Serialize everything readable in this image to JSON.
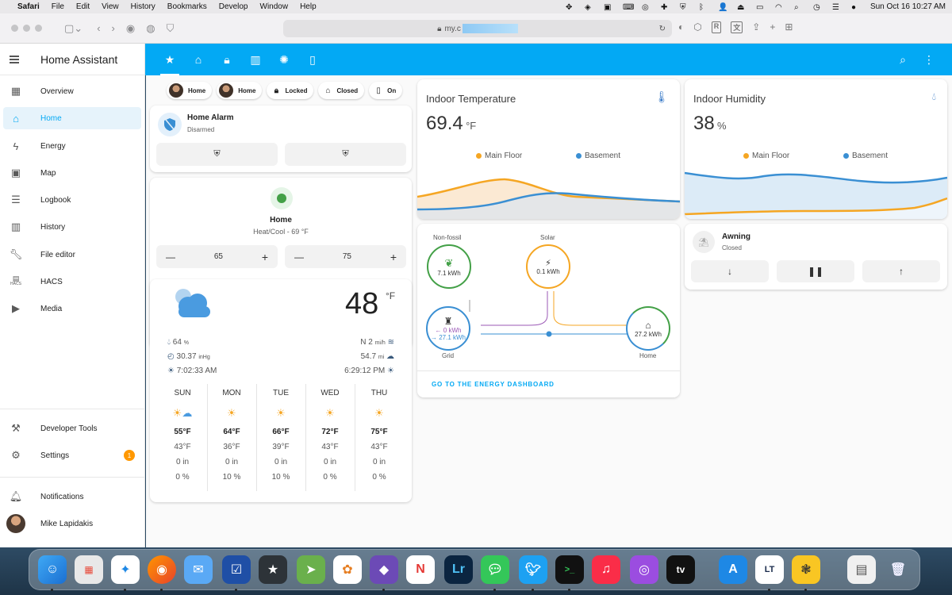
{
  "menubar": {
    "app": "Safari",
    "items": [
      "File",
      "Edit",
      "View",
      "History",
      "Bookmarks",
      "Develop",
      "Window",
      "Help"
    ],
    "clock": "Sun Oct 16  10:27 AM"
  },
  "browser": {
    "url": "my.c"
  },
  "sidebar": {
    "title": "Home Assistant",
    "items": [
      {
        "label": "Overview",
        "icon": "overview-icon"
      },
      {
        "label": "Home",
        "icon": "home-icon"
      },
      {
        "label": "Energy",
        "icon": "lightning-icon"
      },
      {
        "label": "Map",
        "icon": "map-icon"
      },
      {
        "label": "Logbook",
        "icon": "logbook-icon"
      },
      {
        "label": "History",
        "icon": "history-icon"
      },
      {
        "label": "File editor",
        "icon": "wrench-icon"
      },
      {
        "label": "HACS",
        "icon": "hacs-icon"
      },
      {
        "label": "Media",
        "icon": "media-icon"
      }
    ],
    "dev_tools": "Developer Tools",
    "settings": "Settings",
    "settings_badge": "1",
    "notifications": "Notifications",
    "user": "Mike Lapidakis",
    "hacs_small": "HACS"
  },
  "chips": [
    {
      "label": "Home",
      "type": "avatar"
    },
    {
      "label": "Home",
      "type": "avatar"
    },
    {
      "label": "Locked",
      "type": "lock-icon"
    },
    {
      "label": "Closed",
      "type": "garage-icon"
    },
    {
      "label": "On",
      "type": "power-icon"
    }
  ],
  "alarm": {
    "name": "Home Alarm",
    "state": "Disarmed"
  },
  "thermostat": {
    "name": "Home",
    "mode": "Heat/Cool - 69 °F",
    "low": "65",
    "high": "75",
    "minus": "—",
    "plus": "+"
  },
  "weather": {
    "temp": "48",
    "unit": "°F",
    "humidity": "64",
    "humidity_unit": "%",
    "pressure": "30.37",
    "pressure_unit": "inHg",
    "sunrise": "7:02:33 AM",
    "wind": "N 2",
    "wind_unit": "mi/h",
    "visibility": "54.7",
    "visibility_unit": "mi",
    "sunset": "6:29:12 PM",
    "forecast": [
      {
        "day": "SUN",
        "high": "55°F",
        "low": "43°F",
        "precip": "0 in",
        "chance": "0 %",
        "icon": "partly-cloudy-icon"
      },
      {
        "day": "MON",
        "high": "64°F",
        "low": "36°F",
        "precip": "0 in",
        "chance": "10 %",
        "icon": "sunny-icon"
      },
      {
        "day": "TUE",
        "high": "66°F",
        "low": "39°F",
        "precip": "0 in",
        "chance": "10 %",
        "icon": "sunny-icon"
      },
      {
        "day": "WED",
        "high": "72°F",
        "low": "43°F",
        "precip": "0 in",
        "chance": "0 %",
        "icon": "sunny-icon"
      },
      {
        "day": "THU",
        "high": "75°F",
        "low": "43°F",
        "precip": "0 in",
        "chance": "0 %",
        "icon": "sunny-icon"
      }
    ]
  },
  "indoor_temp": {
    "title": "Indoor Temperature",
    "value": "69.4",
    "unit": "°F",
    "series": [
      "Main Floor",
      "Basement"
    ]
  },
  "indoor_humidity": {
    "title": "Indoor Humidity",
    "value": "38",
    "unit": "%",
    "series": [
      "Main Floor",
      "Basement"
    ]
  },
  "energy": {
    "nonfossil_label": "Non-fossil",
    "nonfossil_value": "7.1 kWh",
    "solar_label": "Solar",
    "solar_value": "0.1 kWh",
    "grid_in": "← 0 kWh",
    "grid_out": "→ 27.1 kWh",
    "grid_label": "Grid",
    "home_value": "27.2 kWh",
    "home_label": "Home",
    "link": "GO TO THE ENERGY DASHBOARD"
  },
  "awning": {
    "name": "Awning",
    "state": "Closed"
  },
  "colors": {
    "accent": "#03a9f4",
    "main_floor": "#f5a623",
    "basement": "#3a8fd3"
  }
}
